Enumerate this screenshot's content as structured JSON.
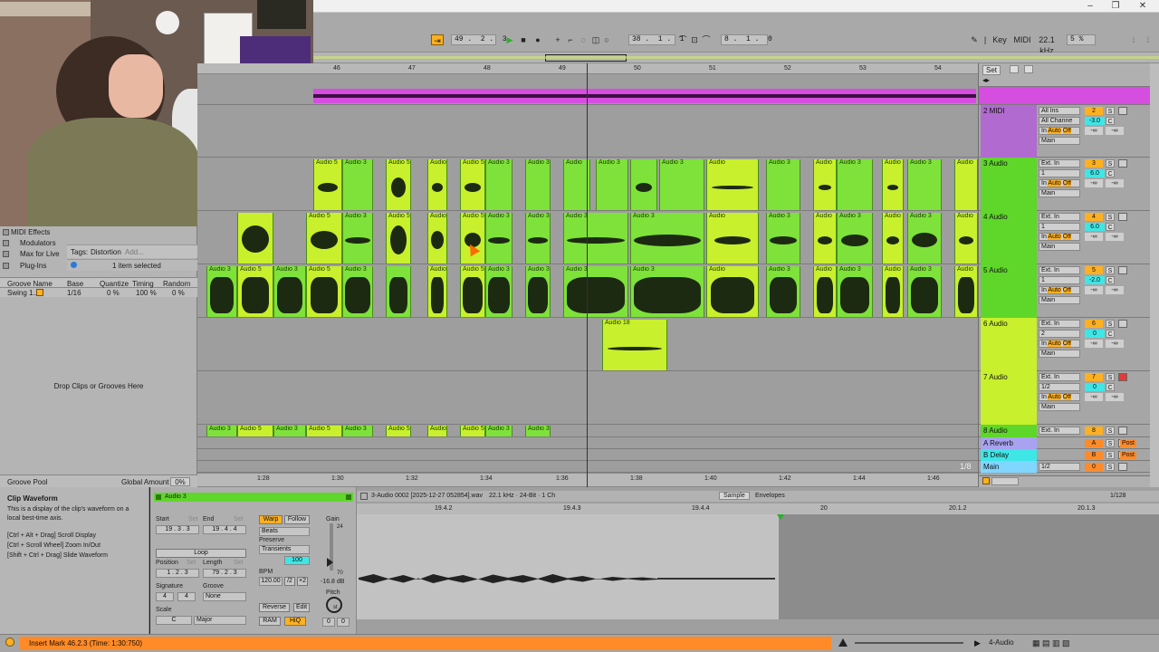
{
  "transport": {
    "position": "49 .  2 .  3",
    "loop_start": "38 .  1 .  1",
    "loop_length": "8 .  1 .  0",
    "key_label": "Key",
    "midi_label": "MIDI",
    "sample_rate": "22.1 kHz",
    "cpu": "5 %"
  },
  "browser": {
    "items": [
      {
        "label": "MIDI Effects"
      },
      {
        "label": "Modulators"
      },
      {
        "label": "Max for Live"
      },
      {
        "label": "Plug-Ins"
      }
    ],
    "tags_label": "Tags:",
    "tag": "Distortion",
    "tag_add": "Add...",
    "selection_count": "1 item selected",
    "groove_columns": [
      "Groove Name",
      "Base",
      "Quantize",
      "Timing",
      "Random"
    ],
    "groove_row": [
      "Swing 1...",
      "1/16",
      "0 %",
      "100 %",
      "0 %"
    ],
    "drop_hint": "Drop Clips or Grooves Here",
    "groove_pool_label": "Groove Pool",
    "global_amount_label": "Global Amount",
    "global_amount_value": "0%"
  },
  "arrangement": {
    "bars": [
      "46",
      "47",
      "48",
      "49",
      "50",
      "51",
      "52",
      "53",
      "54"
    ],
    "times": [
      "1:28",
      "1:30",
      "1:32",
      "1:34",
      "1:36",
      "1:38",
      "1:40",
      "1:42",
      "1:44",
      "1:46"
    ],
    "zoom_ratio": "1/8",
    "set_button": "Set",
    "clip_names": {
      "audio3": "Audio 3",
      "audio5": "Audio 5",
      "audio": "Audio",
      "audio18": "Audio 18"
    }
  },
  "tracks": [
    {
      "name": "2 MIDI",
      "input": "All Ins",
      "channel": "All Channe",
      "num": "2",
      "vol": "-3.0",
      "color": "#b06ad0"
    },
    {
      "name": "3 Audio",
      "input": "Ext. In",
      "channel": "1",
      "num": "3",
      "vol": "6.0",
      "color": "#5fd62a"
    },
    {
      "name": "4 Audio",
      "input": "Ext. In",
      "channel": "1",
      "num": "4",
      "vol": "6.0",
      "color": "#5fd62a"
    },
    {
      "name": "5 Audio",
      "input": "Ext. In",
      "channel": "1",
      "num": "5",
      "vol": "-2.0",
      "color": "#5fd62a"
    },
    {
      "name": "6 Audio",
      "input": "Ext. In",
      "channel": "2",
      "num": "6",
      "vol": "0",
      "color": "#c8f02c"
    },
    {
      "name": "7 Audio",
      "input": "Ext. In",
      "channel": "1/2",
      "num": "7",
      "vol": "0",
      "color": "#c8f02c"
    },
    {
      "name": "8 Audio",
      "input": "Ext. In",
      "channel": "",
      "num": "8",
      "vol": "",
      "color": "#5fd62a"
    },
    {
      "name": "A Reverb",
      "input": "",
      "channel": "",
      "num": "A",
      "vol": "",
      "color": "#a8a2f0"
    },
    {
      "name": "B Delay",
      "input": "",
      "channel": "",
      "num": "B",
      "vol": "",
      "color": "#3ee6e6"
    },
    {
      "name": "Main",
      "input": "",
      "channel": "1/2",
      "num": "0",
      "vol": "",
      "color": "#7fd6ff"
    }
  ],
  "routing": {
    "in": "In",
    "auto": "Auto",
    "off": "Off",
    "main": "Main",
    "minus_inf": "-∞",
    "solo": "S",
    "post": "Post",
    "mono": "C"
  },
  "info": {
    "title": "Clip Waveform",
    "body": "This is a display of the clip's waveform on a local best-time axis.",
    "shortcuts": [
      "[Ctrl + Alt + Drag] Scroll Display",
      "[Ctrl + Scroll Wheel] Zoom In/Out",
      "[Shift + Ctrl + Drag] Slide Waveform"
    ]
  },
  "clip": {
    "name": "Audio 3",
    "start_label": "Start",
    "set_label": "Set",
    "end_label": "End",
    "start": "19 .  3 .  3",
    "end": "19 .  4 .  4",
    "loop_label": "Loop",
    "position_label": "Position",
    "length_label": "Length",
    "position": "1 .  2 .  3",
    "length": "79 .  2 .  3",
    "signature_label": "Signature",
    "sig_num": "4",
    "sig_den": "4",
    "groove_label": "Groove",
    "groove_value": "None",
    "scale_label": "Scale",
    "scale_root": "C",
    "scale_mode": "Major",
    "warp": "Warp",
    "follow": "Follow",
    "warp_mode": "Beats",
    "preserve_label": "Preserve",
    "preserve_value": "Transients",
    "bpm_label": "BPM",
    "bpm": "120.00",
    "half": "/2",
    "double": "×2",
    "gain_label": "Gain",
    "gain_db": "-16.8 dB",
    "pitch_label": "Pitch",
    "pitch": "0",
    "pitch_fine": "0",
    "semitone_unit": "st",
    "reverse": "Reverse",
    "edit": "Edit",
    "ram": "RAM",
    "hiq": "HiQ",
    "gain_top": "24",
    "gain_bottom": "70",
    "grain": "100"
  },
  "sample": {
    "file": "3-Audio 0002 [2025-12-27 052854].wav",
    "format": "22.1 kHz · 24-Bit · 1 Ch",
    "tab_sample": "Sample",
    "tab_envelopes": "Envelopes",
    "quant": "1/128",
    "ruler": [
      "19.4.2",
      "19.4.3",
      "19.4.4",
      "20",
      "20.1.2",
      "20.1.3"
    ]
  },
  "status": {
    "message": "Insert Mark 46.2.3 (Time: 1:30:750)",
    "track": "4-Audio"
  },
  "colors": {
    "green_clip": "#7ee23a",
    "yellow_clip": "#c8f02c",
    "midi_clip": "#d64ee0",
    "accent_orange": "#ff8a28"
  }
}
